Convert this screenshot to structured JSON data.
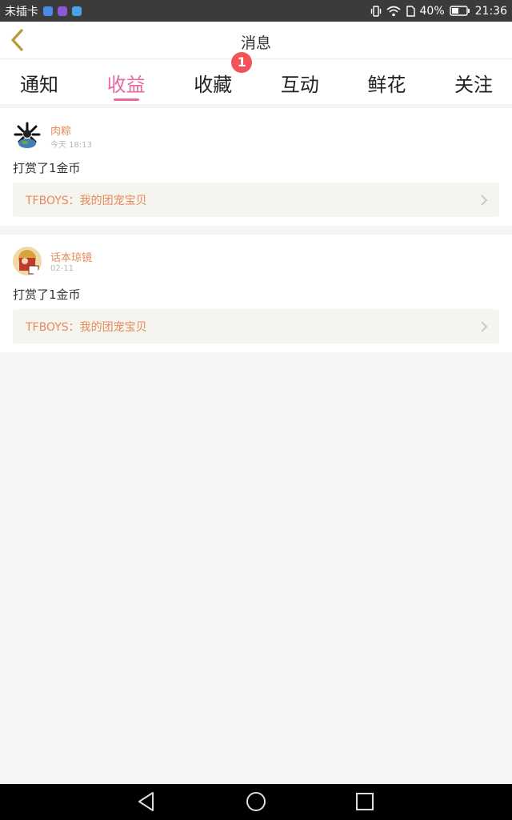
{
  "status": {
    "carrier": "未插卡",
    "battery": "40%",
    "time": "21:36",
    "icons": [
      "notification-app-icon",
      "notification-app-icon",
      "notification-app-icon",
      "vibrate-icon",
      "wifi-icon",
      "sim-icon",
      "battery-icon"
    ]
  },
  "header": {
    "title": "消息",
    "back_icon": "chevron-left-icon"
  },
  "tabs": [
    {
      "label": "通知",
      "active": false
    },
    {
      "label": "收益",
      "active": true
    },
    {
      "label": "收藏",
      "active": false,
      "badge": "1"
    },
    {
      "label": "互动",
      "active": false
    },
    {
      "label": "鲜花",
      "active": false
    },
    {
      "label": "关注",
      "active": false
    }
  ],
  "messages": [
    {
      "user": "肉粽",
      "time": "今天 18:13",
      "text": "打赏了1金币",
      "link": "TFBOYS：我的团宠宝贝"
    },
    {
      "user": "话本琼镜",
      "time": "02-11",
      "text": "打赏了1金币",
      "link": "TFBOYS：我的团宠宝贝"
    }
  ],
  "colors": {
    "accent": "#e56aa2",
    "name": "#e58a5a",
    "badge": "#f25359",
    "statusbar": "#3b3b3b"
  },
  "nav": [
    "back-triangle-icon",
    "home-circle-icon",
    "recents-square-icon"
  ]
}
